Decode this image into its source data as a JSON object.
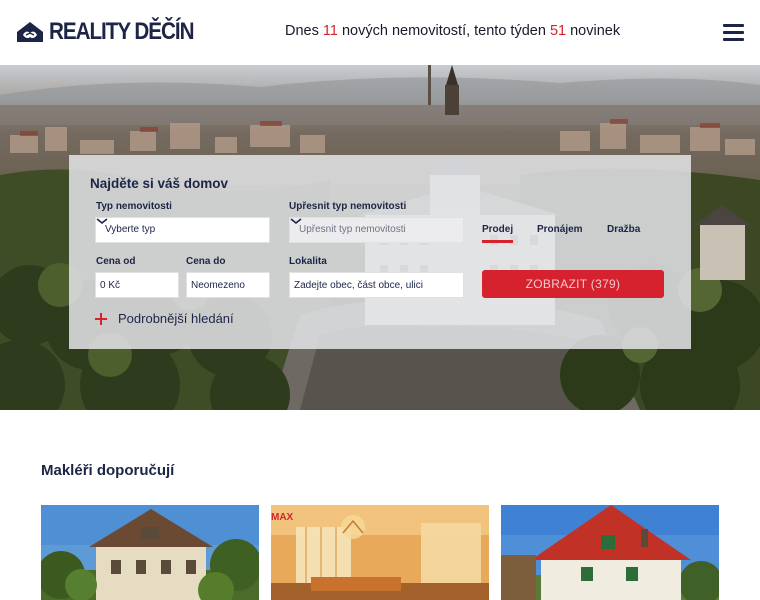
{
  "header": {
    "logo_text": "REALITY DĚČÍN",
    "logo_icon": "house-handshake-icon",
    "tagline": {
      "prefix": "Dnes",
      "today_count": "11",
      "middle": "nových nemovitostí, tento týden",
      "week_count": "51",
      "suffix": "novinek"
    },
    "menu_icon": "hamburger-menu-icon"
  },
  "search": {
    "title": "Najděte si váš domov",
    "type_label": "Typ nemovitosti",
    "type_value": "Vyberte typ",
    "subtype_label": "Upřesnit typ nemovitosti",
    "subtype_value": "Upřesnit typ nemovitosti",
    "tabs": [
      {
        "label": "Prodej",
        "active": true
      },
      {
        "label": "Pronájem",
        "active": false
      },
      {
        "label": "Dražba",
        "active": false
      }
    ],
    "price_from_label": "Cena od",
    "price_from_value": "0 Kč",
    "price_to_label": "Cena do",
    "price_to_value": "Neomezeno",
    "location_label": "Lokalita",
    "location_placeholder": "Zadejte obec, část obce, ulici",
    "submit_label": "ZOBRAZIT (379)",
    "advanced_label": "Podrobnější hledání"
  },
  "brokers": {
    "title": "Makléři doporučují",
    "card_badge": "MAX"
  },
  "colors": {
    "brand_navy": "#1c2546",
    "accent_red": "#d6222e"
  }
}
